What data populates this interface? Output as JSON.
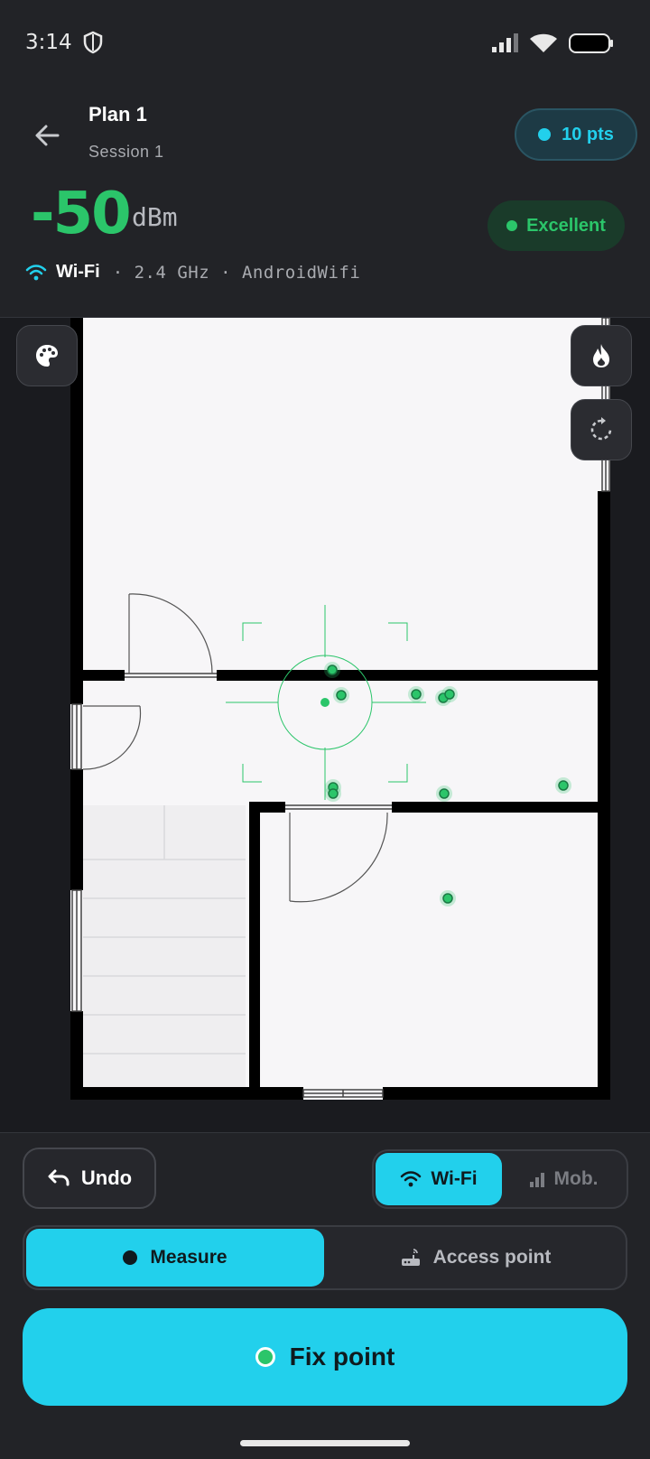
{
  "status_bar": {
    "time": "3:14"
  },
  "header": {
    "title": "Plan 1",
    "subtitle": "Session 1",
    "points_badge": "10 pts",
    "signal_value": "-50",
    "signal_unit": "dBm",
    "quality": "Excellent",
    "network_type": "Wi-Fi",
    "network_info": "· 2.4 GHz · AndroidWifi"
  },
  "map": {
    "buttons": [
      "palette-icon",
      "heatmap-icon",
      "rotate-icon"
    ],
    "measured_points": 10
  },
  "panel": {
    "undo_label": "Undo",
    "network_toggle": {
      "options": [
        "Wi-Fi",
        "Mob."
      ],
      "selected": "Wi-Fi"
    },
    "mode_toggle": {
      "options": [
        "Measure",
        "Access point"
      ],
      "selected": "Measure"
    },
    "fix_label": "Fix point"
  },
  "colors": {
    "accent": "#22d0ec",
    "signal_good": "#2bc56a",
    "background": "#1a1b1f",
    "panel": "#222327"
  }
}
